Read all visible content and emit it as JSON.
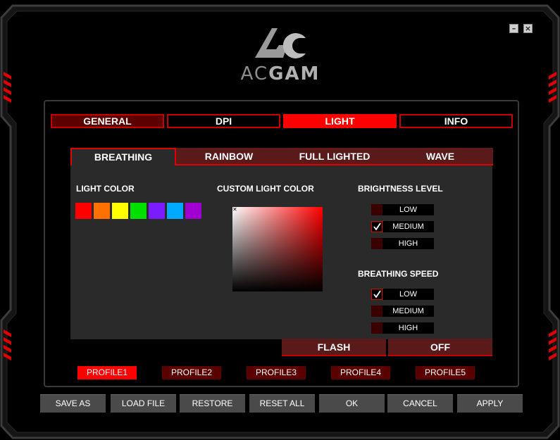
{
  "window": {
    "minimize_glyph": "–",
    "close_glyph": "×"
  },
  "logo": {
    "text_light": "AC",
    "text_bold": "GAM"
  },
  "main_tabs": [
    {
      "label": "GENERAL"
    },
    {
      "label": "DPI"
    },
    {
      "label": "LIGHT",
      "active": true
    },
    {
      "label": "INFO"
    }
  ],
  "light_tabs": [
    {
      "label": "BREATHING",
      "active": true
    },
    {
      "label": "RAINBOW"
    },
    {
      "label": "FULL LIGHTED"
    },
    {
      "label": "WAVE"
    }
  ],
  "light_color": {
    "label": "LIGHT COLOR",
    "swatches": [
      "#ff0000",
      "#ff7000",
      "#ffff00",
      "#00e000",
      "#7a1cff",
      "#00aaff",
      "#a000d0"
    ]
  },
  "custom_color": {
    "label": "CUSTOM LIGHT COLOR",
    "cursor_glyph": "✕"
  },
  "brightness": {
    "label": "BRIGHTNESS LEVEL",
    "options": [
      {
        "label": "LOW",
        "checked": false
      },
      {
        "label": "MEDIUM",
        "checked": true
      },
      {
        "label": "HIGH",
        "checked": false
      }
    ]
  },
  "breathing_speed": {
    "label": "BREATHING SPEED",
    "options": [
      {
        "label": "LOW",
        "checked": true
      },
      {
        "label": "MEDIUM",
        "checked": false
      },
      {
        "label": "HIGH",
        "checked": false
      }
    ]
  },
  "actions": {
    "flash": "FLASH",
    "off": "OFF"
  },
  "profiles": [
    {
      "label": "PROFILE1",
      "active": true
    },
    {
      "label": "PROFILE2"
    },
    {
      "label": "PROFILE3"
    },
    {
      "label": "PROFILE4"
    },
    {
      "label": "PROFILE5"
    }
  ],
  "bottom_buttons": {
    "save_as": "SAVE AS",
    "load_file": "LOAD FILE",
    "restore": "RESTORE",
    "reset_all": "RESET ALL",
    "ok": "OK",
    "cancel": "CANCEL",
    "apply": "APPLY"
  },
  "colors": {
    "accent": "#ff0000",
    "dark_red": "#5a0000",
    "panel": "#2a2a2a"
  }
}
